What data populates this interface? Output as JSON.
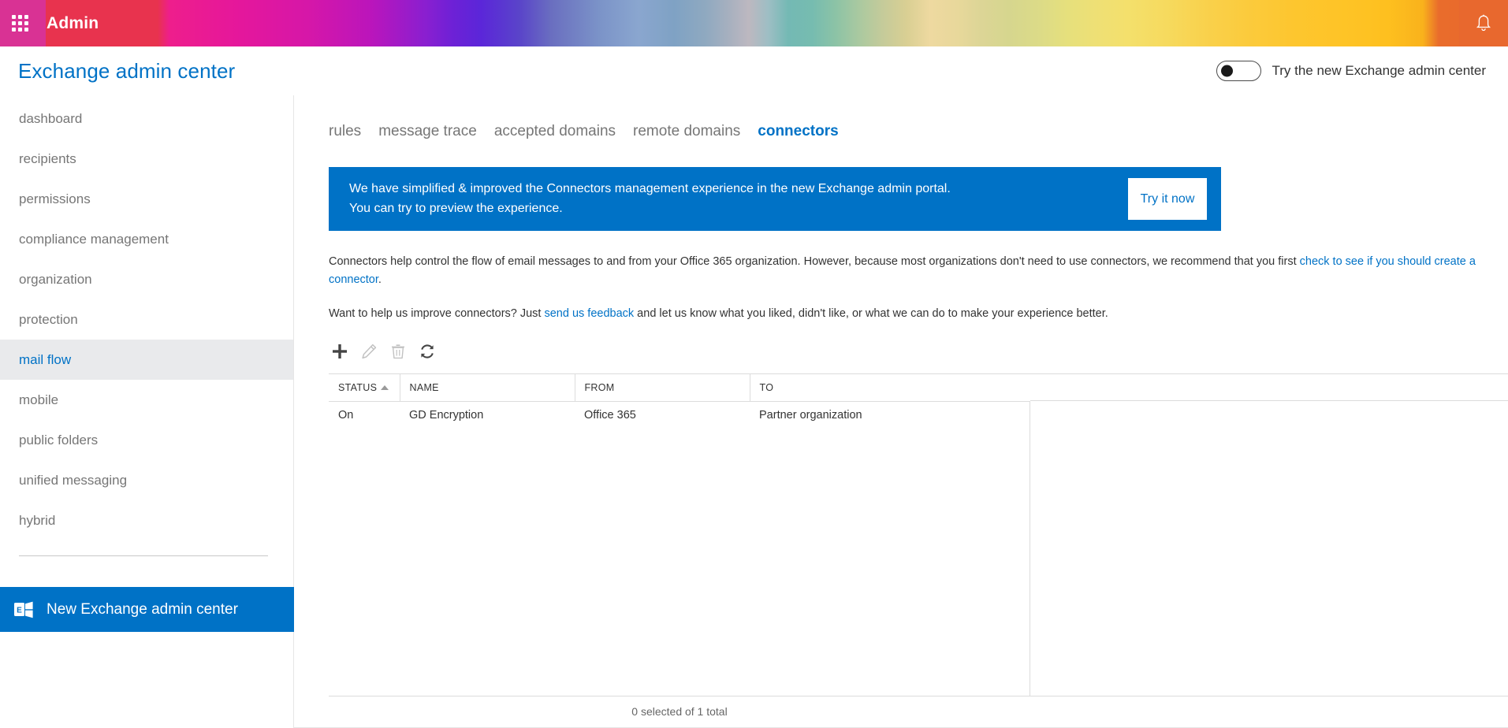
{
  "suite": {
    "waffle_icon": "app-launcher-waffle-icon",
    "brand": "Admin",
    "bell_icon": "notification-bell-icon"
  },
  "header": {
    "title": "Exchange admin center",
    "toggle_label": "Try the new Exchange admin center",
    "toggle_state": "off"
  },
  "sidebar": {
    "items": [
      {
        "label": "dashboard",
        "selected": false
      },
      {
        "label": "recipients",
        "selected": false
      },
      {
        "label": "permissions",
        "selected": false
      },
      {
        "label": "compliance management",
        "selected": false
      },
      {
        "label": "organization",
        "selected": false
      },
      {
        "label": "protection",
        "selected": false
      },
      {
        "label": "mail flow",
        "selected": true
      },
      {
        "label": "mobile",
        "selected": false
      },
      {
        "label": "public folders",
        "selected": false
      },
      {
        "label": "unified messaging",
        "selected": false
      },
      {
        "label": "hybrid",
        "selected": false
      }
    ],
    "new_eac": {
      "label": "New Exchange admin center",
      "icon": "exchange-logo-icon"
    }
  },
  "main": {
    "tabs": [
      {
        "label": "rules",
        "active": false
      },
      {
        "label": "message trace",
        "active": false
      },
      {
        "label": "accepted domains",
        "active": false
      },
      {
        "label": "remote domains",
        "active": false
      },
      {
        "label": "connectors",
        "active": true
      }
    ],
    "promo": {
      "line1": "We have simplified & improved the Connectors management experience in the new Exchange admin portal.",
      "line2": "You can try to preview the experience.",
      "button": "Try it now"
    },
    "info": {
      "p1_before": "Connectors help control the flow of email messages to and from your Office 365 organization. However, because most organizations don't need to use connectors, we recommend that you first ",
      "p1_link": "check to see if you should create a connector",
      "p1_after": ".",
      "p2_before": "Want to help us improve connectors? Just ",
      "p2_link": "send us feedback",
      "p2_after": " and let us know what you liked, didn't like, or what we can do to make your experience better."
    },
    "toolbar": [
      {
        "name": "add-button",
        "icon": "plus-icon",
        "enabled": true
      },
      {
        "name": "edit-button",
        "icon": "pencil-icon",
        "enabled": false
      },
      {
        "name": "delete-button",
        "icon": "trash-icon",
        "enabled": false
      },
      {
        "name": "refresh-button",
        "icon": "refresh-icon",
        "enabled": true
      }
    ],
    "table": {
      "columns": [
        "STATUS",
        "NAME",
        "FROM",
        "TO"
      ],
      "sort_column": "STATUS",
      "sort_direction": "ascending",
      "rows": [
        {
          "status": "On",
          "name": "GD Encryption",
          "from": "Office 365",
          "to": "Partner organization"
        }
      ],
      "footer": "0 selected of 1 total"
    }
  },
  "colors": {
    "accent_blue": "#0072c6",
    "bell_orange": "#e8682e",
    "selected_nav_bg": "#e9eaec",
    "muted_text": "#767676"
  }
}
